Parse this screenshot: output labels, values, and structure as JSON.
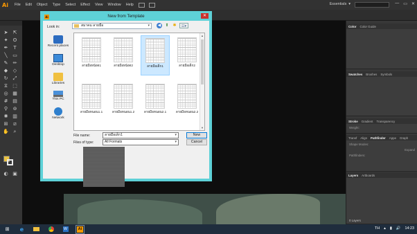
{
  "app": {
    "logo": "Ai",
    "menu": [
      "File",
      "Edit",
      "Object",
      "Type",
      "Select",
      "Effect",
      "View",
      "Window",
      "Help"
    ],
    "workspace": "Essentials",
    "window_controls": [
      "—",
      "▭",
      "✕"
    ]
  },
  "panels": {
    "color": [
      "Color",
      "Color Guide"
    ],
    "swatches": [
      "Swatches",
      "Brushes",
      "Symbols"
    ],
    "stroke": [
      "Stroke",
      "Gradient",
      "Transparency"
    ],
    "stroke_weight_label": "Weight:",
    "pathfinder": [
      "Transf",
      "Align",
      "Pathfinder",
      "Appe",
      "Graph"
    ],
    "shape_modes_label": "Shape Modes:",
    "pathfinders_label": "Pathfinders:",
    "expand_label": "Expand",
    "layers": [
      "Layers",
      "Artboards"
    ],
    "layers_count": "0 Layers"
  },
  "taskbar": {
    "language": "TH",
    "time": "14:23"
  },
  "dialog": {
    "title": "New from Template",
    "app_icon": "Ai",
    "close": "✕",
    "look_in_label": "Look in:",
    "look_in_value": "สมาคม ลายมือ",
    "places": [
      {
        "label": "Recent places",
        "icon": "recent-places-icon"
      },
      {
        "label": "Desktop",
        "icon": "desktop-icon"
      },
      {
        "label": "Libraries",
        "icon": "libraries-icon"
      },
      {
        "label": "This PC",
        "icon": "this-pc-icon"
      },
      {
        "label": "Network",
        "icon": "network-icon"
      }
    ],
    "files": [
      {
        "name": "ลายมือหนังด1",
        "selected": false
      },
      {
        "name": "ลายมือหนังด2",
        "selected": false
      },
      {
        "name": "ลายมือเด็ก1",
        "selected": true
      },
      {
        "name": "ลายมือเด็ก2",
        "selected": false
      },
      {
        "name": "ลายมือหนอน1.1",
        "selected": false
      },
      {
        "name": "ลายมือหนอน1.2",
        "selected": false
      },
      {
        "name": "ลายมือหนอน2.1",
        "selected": false
      },
      {
        "name": "ลายมือหนอน2.2",
        "selected": false
      }
    ],
    "file_name_label": "File name:",
    "file_name_value": "ลายมือเด็ก1",
    "file_type_label": "Files of type:",
    "file_type_value": "All Formats",
    "new_button": "New",
    "cancel_button": "Cancel"
  }
}
